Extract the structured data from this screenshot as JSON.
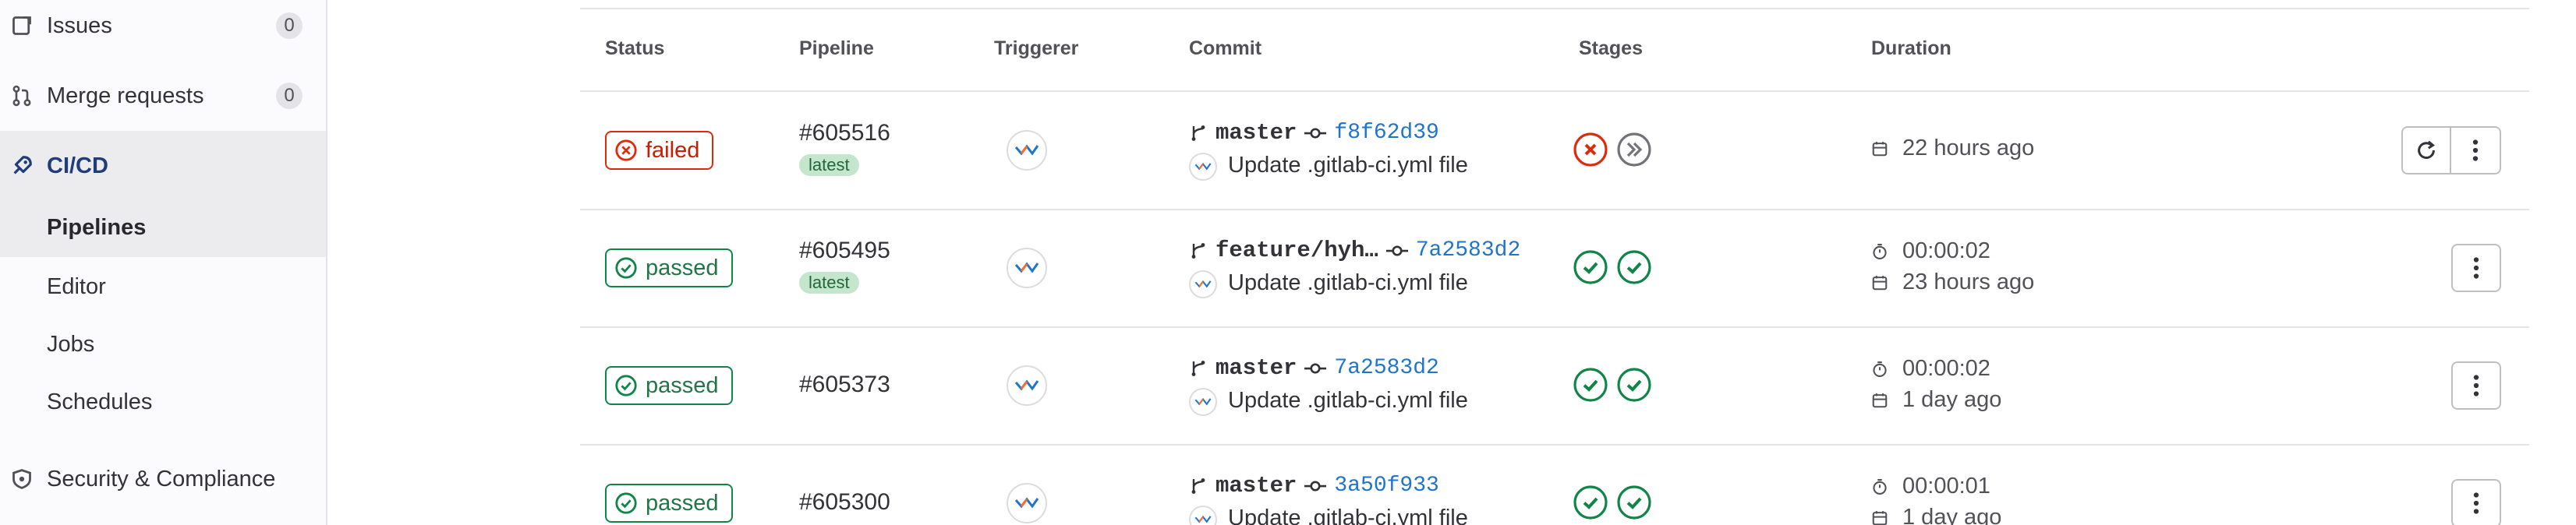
{
  "sidebar": {
    "issues": {
      "label": "Issues",
      "count": "0"
    },
    "merge_requests": {
      "label": "Merge requests",
      "count": "0"
    },
    "cicd": {
      "label": "CI/CD"
    },
    "sub_items": [
      "Pipelines",
      "Editor",
      "Jobs",
      "Schedules"
    ],
    "active_sub": "Pipelines",
    "security": {
      "label": "Security & Compliance"
    }
  },
  "table": {
    "headers": {
      "status": "Status",
      "pipeline": "Pipeline",
      "triggerer": "Triggerer",
      "commit": "Commit",
      "stages": "Stages",
      "duration": "Duration"
    },
    "rows": [
      {
        "status": "failed",
        "pipeline_id": "#605516",
        "tag": "latest",
        "ref": "master",
        "sha": "f8f62d39",
        "message": "Update .gitlab-ci.yml file",
        "stages": [
          "failed",
          "skipped"
        ],
        "duration": "",
        "finished": "22 hours ago"
      },
      {
        "status": "passed",
        "pipeline_id": "#605495",
        "tag": "latest",
        "ref": "feature/hyh…",
        "sha": "7a2583d2",
        "message": "Update .gitlab-ci.yml file",
        "stages": [
          "passed",
          "passed"
        ],
        "duration": "00:00:02",
        "finished": "23 hours ago"
      },
      {
        "status": "passed",
        "pipeline_id": "#605373",
        "tag": "",
        "ref": "master",
        "sha": "7a2583d2",
        "message": "Update .gitlab-ci.yml file",
        "stages": [
          "passed",
          "passed"
        ],
        "duration": "00:00:02",
        "finished": "1 day ago"
      },
      {
        "status": "passed",
        "pipeline_id": "#605300",
        "tag": "",
        "ref": "master",
        "sha": "3a50f933",
        "message": "Update .gitlab-ci.yml file",
        "stages": [
          "passed",
          "passed"
        ],
        "duration": "00:00:01",
        "finished": "1 day ago"
      }
    ]
  },
  "colors": {
    "failed": "#dd2b0e",
    "passed": "#108548",
    "link": "#1f75cb",
    "cicd": "#1f3d7a"
  },
  "icons": {
    "issues": "issues-icon",
    "merge_requests": "merge-request-icon",
    "cicd": "rocket-icon",
    "security": "shield-icon",
    "branch": "branch-icon",
    "commit": "commit-icon",
    "calendar": "calendar-icon",
    "timer": "timer-icon",
    "retry": "retry-icon",
    "more": "more-actions-icon"
  }
}
